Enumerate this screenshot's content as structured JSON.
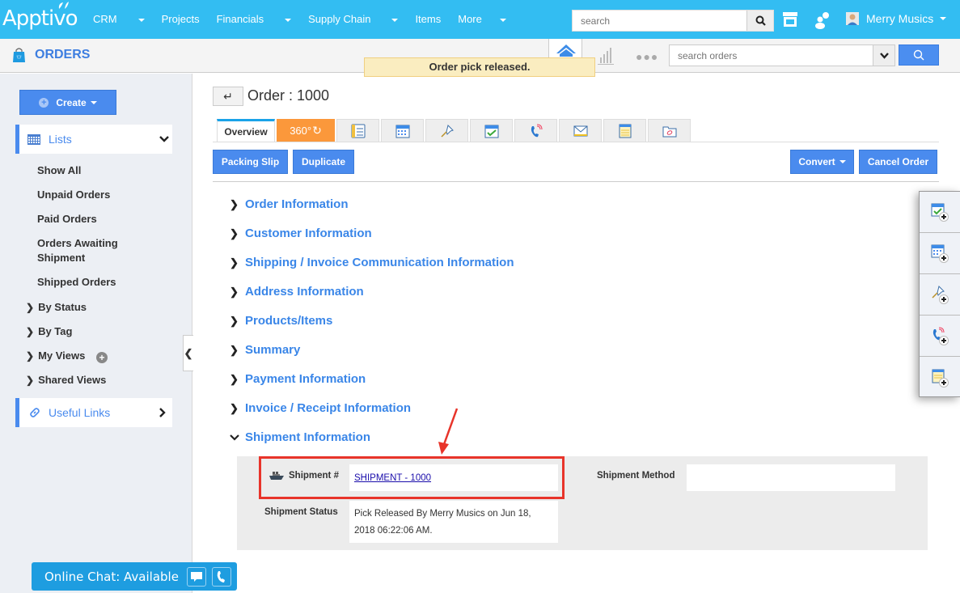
{
  "app": {
    "logo": "Apptivo"
  },
  "nav": {
    "items": [
      {
        "label": "CRM",
        "dropdown": true
      },
      {
        "label": "Projects",
        "dropdown": false
      },
      {
        "label": "Financials",
        "dropdown": true
      },
      {
        "label": "Supply Chain",
        "dropdown": true
      },
      {
        "label": "Items",
        "dropdown": false
      },
      {
        "label": "More",
        "dropdown": true
      }
    ]
  },
  "header": {
    "search_placeholder": "search",
    "user_name": "Merry Musics"
  },
  "subheader": {
    "title": "ORDERS",
    "search_placeholder": "search orders"
  },
  "toast": {
    "message": "Order pick released."
  },
  "sidebar": {
    "create_label": "Create",
    "lists_label": "Lists",
    "list_items": [
      "Show All",
      "Unpaid Orders",
      "Paid Orders",
      "Orders Awaiting Shipment",
      "Shipped Orders"
    ],
    "groups": [
      "By Status",
      "By Tag",
      "My Views",
      "Shared Views"
    ],
    "useful_links_label": "Useful Links"
  },
  "order": {
    "title": "Order : 1000",
    "tabs": {
      "overview": "Overview",
      "t360": "360°",
      "icons": [
        "details-icon",
        "calendar-icon",
        "pin-icon",
        "task-icon",
        "call-icon",
        "email-icon",
        "notes-icon",
        "attachment-icon"
      ]
    },
    "buttons": {
      "packing_slip": "Packing Slip",
      "duplicate": "Duplicate",
      "convert": "Convert",
      "cancel_order": "Cancel Order"
    },
    "sections": [
      {
        "label": "Order Information",
        "expanded": false
      },
      {
        "label": "Customer Information",
        "expanded": false
      },
      {
        "label": "Shipping / Invoice Communication Information",
        "expanded": false
      },
      {
        "label": "Address Information",
        "expanded": false
      },
      {
        "label": "Products/Items",
        "expanded": false
      },
      {
        "label": "Summary",
        "expanded": false
      },
      {
        "label": "Payment Information",
        "expanded": false
      },
      {
        "label": "Invoice / Receipt Information",
        "expanded": false
      },
      {
        "label": "Shipment Information",
        "expanded": true
      }
    ],
    "shipment": {
      "number_label": "Shipment #",
      "number_value": "SHIPMENT - 1000",
      "method_label": "Shipment Method",
      "method_value": "",
      "status_label": "Shipment Status",
      "status_value_line1": "Pick Released By Merry Musics on Jun 18,",
      "status_value_line2": "2018 06:22:06 AM."
    }
  },
  "quick_add": [
    "add-task-icon",
    "add-event-icon",
    "add-followup-icon",
    "add-call-icon",
    "add-note-icon"
  ],
  "chat": {
    "label": "Online Chat: Available"
  },
  "colors": {
    "topbar": "#33bdf2",
    "accent": "#4a8bee",
    "section_link": "#3a86e8",
    "orange_tab": "#fb983b",
    "highlight": "#e8342a"
  }
}
